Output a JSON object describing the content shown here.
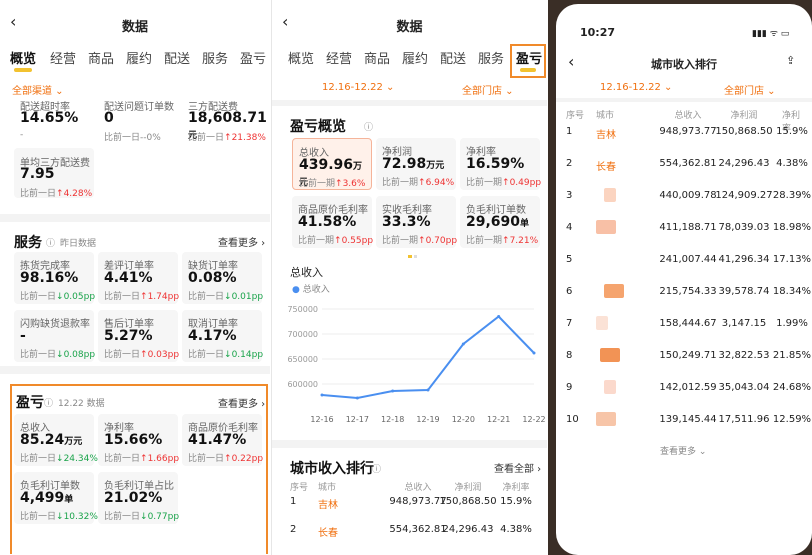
{
  "panel1": {
    "nav_title": "数据",
    "tabs": [
      "概览",
      "经营",
      "商品",
      "履约",
      "配送",
      "服务",
      "盈亏"
    ],
    "channel": "全部渠道",
    "top_metrics": [
      {
        "label": "配送超时率",
        "value": "14.65%",
        "cmp": "-"
      },
      {
        "label": "配送问题订单数",
        "value": "0",
        "cmp": "比前一日--0%"
      },
      {
        "label": "三方配送费",
        "value": "18,608.71",
        "unit": "元",
        "cmp_prefix": "比前一日",
        "cmp": "21.38%"
      }
    ],
    "extra_metric": {
      "label": "单均三方配送费",
      "value": "7.95",
      "cmp_prefix": "比前一日",
      "cmp": "4.28%"
    },
    "service": {
      "title": "服务",
      "hint": "昨日数据",
      "more": "查看更多 ›",
      "metrics": [
        {
          "label": "拣货完成率",
          "value": "98.16%",
          "cmp_prefix": "比前一日",
          "cmp": "0.05pp",
          "dir": "dn"
        },
        {
          "label": "差评订单率",
          "value": "4.41%",
          "cmp_prefix": "比前一日",
          "cmp": "1.74pp",
          "dir": "up"
        },
        {
          "label": "缺货订单率",
          "value": "0.08%",
          "cmp_prefix": "比前一日",
          "cmp": "0.01pp",
          "dir": "dn"
        },
        {
          "label": "闪购缺货退款率",
          "value": "-",
          "cmp_prefix": "比前一日",
          "cmp": "0.08pp",
          "dir": "dn"
        },
        {
          "label": "售后订单率",
          "value": "5.27%",
          "cmp_prefix": "比前一日",
          "cmp": "0.03pp",
          "dir": "up"
        },
        {
          "label": "取消订单率",
          "value": "4.17%",
          "cmp_prefix": "比前一日",
          "cmp": "0.14pp",
          "dir": "dn"
        }
      ]
    },
    "profit": {
      "title": "盈亏",
      "hint": "12.22 数据",
      "more": "查看更多 ›",
      "metrics": [
        {
          "label": "总收入",
          "value": "85.24",
          "unit": "万元",
          "cmp_prefix": "比前一日",
          "cmp": "24.34%",
          "dir": "dn"
        },
        {
          "label": "净利率",
          "value": "15.66%",
          "cmp_prefix": "比前一日",
          "cmp": "1.66pp",
          "dir": "up"
        },
        {
          "label": "商品原价毛利率",
          "value": "41.47%",
          "cmp_prefix": "比前一日",
          "cmp": "0.22pp",
          "dir": "up"
        },
        {
          "label": "负毛利订单数",
          "value": "4,499",
          "unit": "单",
          "cmp_prefix": "比前一日",
          "cmp": "10.32%",
          "dir": "dn"
        },
        {
          "label": "负毛利订单占比",
          "value": "21.02%",
          "cmp_prefix": "比前一日",
          "cmp": "0.77pp",
          "dir": "dn"
        }
      ]
    }
  },
  "panel2": {
    "nav_title": "数据",
    "tabs": [
      "概览",
      "经营",
      "商品",
      "履约",
      "配送",
      "服务",
      "盈亏"
    ],
    "date_range": "12.16-12.22",
    "store": "全部门店",
    "section_title": "盈亏概览",
    "metrics": [
      {
        "label": "总收入",
        "value": "439.96",
        "unit": "万元",
        "cmp_prefix": "比前一期",
        "cmp": "3.6%",
        "dir": "up"
      },
      {
        "label": "净利润",
        "value": "72.98",
        "unit": "万元",
        "cmp_prefix": "比前一期",
        "cmp": "6.94%",
        "dir": "up"
      },
      {
        "label": "净利率",
        "value": "16.59%",
        "cmp_prefix": "比前一期",
        "cmp": "0.49pp",
        "dir": "up"
      },
      {
        "label": "商品原价毛利率",
        "value": "41.58%",
        "cmp_prefix": "比前一期",
        "cmp": "0.55pp",
        "dir": "up"
      },
      {
        "label": "实收毛利率",
        "value": "33.3%",
        "cmp_prefix": "比前一期",
        "cmp": "0.70pp",
        "dir": "up"
      },
      {
        "label": "负毛利订单数",
        "value": "29,690",
        "unit": "单",
        "cmp_prefix": "比前一期",
        "cmp": "7.21%",
        "dir": "up"
      }
    ],
    "chart_title": "总收入",
    "legend": "总收入",
    "table_title": "城市收入排行",
    "table_more": "查看全部 ›",
    "headers": [
      "序号",
      "城市",
      "总收入",
      "净利润",
      "净利率"
    ],
    "rows": [
      [
        "1",
        "吉林",
        "948,973.77",
        "150,868.50",
        "15.9%"
      ],
      [
        "2",
        "长春",
        "554,362.81",
        "24,296.43",
        "4.38%"
      ]
    ]
  },
  "chart_data": {
    "type": "line",
    "title": "总收入",
    "x": [
      "12-16",
      "12-17",
      "12-18",
      "12-19",
      "12-20",
      "12-21",
      "12-22"
    ],
    "series": [
      {
        "name": "总收入",
        "values": [
          578000,
          572000,
          586000,
          588000,
          680000,
          735000,
          662000
        ]
      }
    ],
    "yticks": [
      600000,
      650000,
      700000,
      750000
    ],
    "ylim": [
      560000,
      760000
    ],
    "color": "#4a8ff0"
  },
  "panel3": {
    "time": "10:27",
    "status_icons": "▮▮▮ ᯤ ▭",
    "title": "城市收入排行",
    "date_range": "12.16-12.22",
    "store": "全部门店",
    "headers": [
      "序号",
      "城市",
      "总收入",
      "净利润",
      "净利率"
    ],
    "rows": [
      {
        "rank": "1",
        "city": "吉林",
        "revenue": "948,973.77",
        "profit": "150,868.50",
        "rate": "15.9%"
      },
      {
        "rank": "2",
        "city": "长春",
        "revenue": "554,362.81",
        "profit": "24,296.43",
        "rate": "4.38%"
      },
      {
        "rank": "3",
        "city": "",
        "revenue": "440,009.78",
        "profit": "124,909.27",
        "rate": "28.39%"
      },
      {
        "rank": "4",
        "city": "",
        "revenue": "411,188.71",
        "profit": "78,039.03",
        "rate": "18.98%"
      },
      {
        "rank": "5",
        "city": "",
        "revenue": "241,007.44",
        "profit": "41,296.34",
        "rate": "17.13%"
      },
      {
        "rank": "6",
        "city": "",
        "revenue": "215,754.33",
        "profit": "39,578.74",
        "rate": "18.34%"
      },
      {
        "rank": "7",
        "city": "",
        "revenue": "158,444.67",
        "profit": "3,147.15",
        "rate": "1.99%"
      },
      {
        "rank": "8",
        "city": "",
        "revenue": "150,249.71",
        "profit": "32,822.53",
        "rate": "21.85%"
      },
      {
        "rank": "9",
        "city": "",
        "revenue": "142,012.59",
        "profit": "35,043.04",
        "rate": "24.68%"
      },
      {
        "rank": "10",
        "city": "",
        "revenue": "139,145.44",
        "profit": "17,511.96",
        "rate": "12.59%"
      }
    ],
    "more": "查看更多 ⌄"
  }
}
